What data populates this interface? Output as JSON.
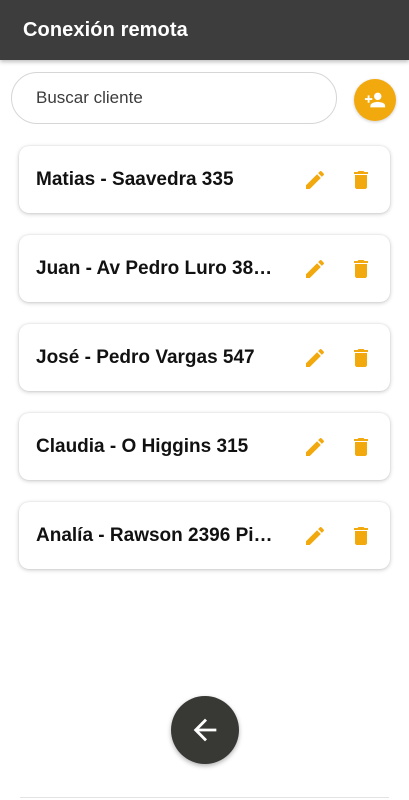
{
  "app_bar": {
    "title": "Conexión remota"
  },
  "search": {
    "placeholder": "Buscar cliente",
    "value": ""
  },
  "add_client": {
    "icon": "person-add-icon"
  },
  "clients": [
    {
      "label": "Matias - Saavedra 335"
    },
    {
      "label": "Juan - Av Pedro Luro 38…"
    },
    {
      "label": "José - Pedro Vargas 547"
    },
    {
      "label": "Claudia - O Higgins 315"
    },
    {
      "label": "Analía - Rawson 2396 Pi…"
    }
  ],
  "icons": {
    "edit": "pencil-icon",
    "delete": "trash-icon",
    "back": "arrow-back-icon"
  },
  "colors": {
    "accent": "#f2a90d",
    "app_bar": "#3d3d3d",
    "back_button": "#383935"
  }
}
